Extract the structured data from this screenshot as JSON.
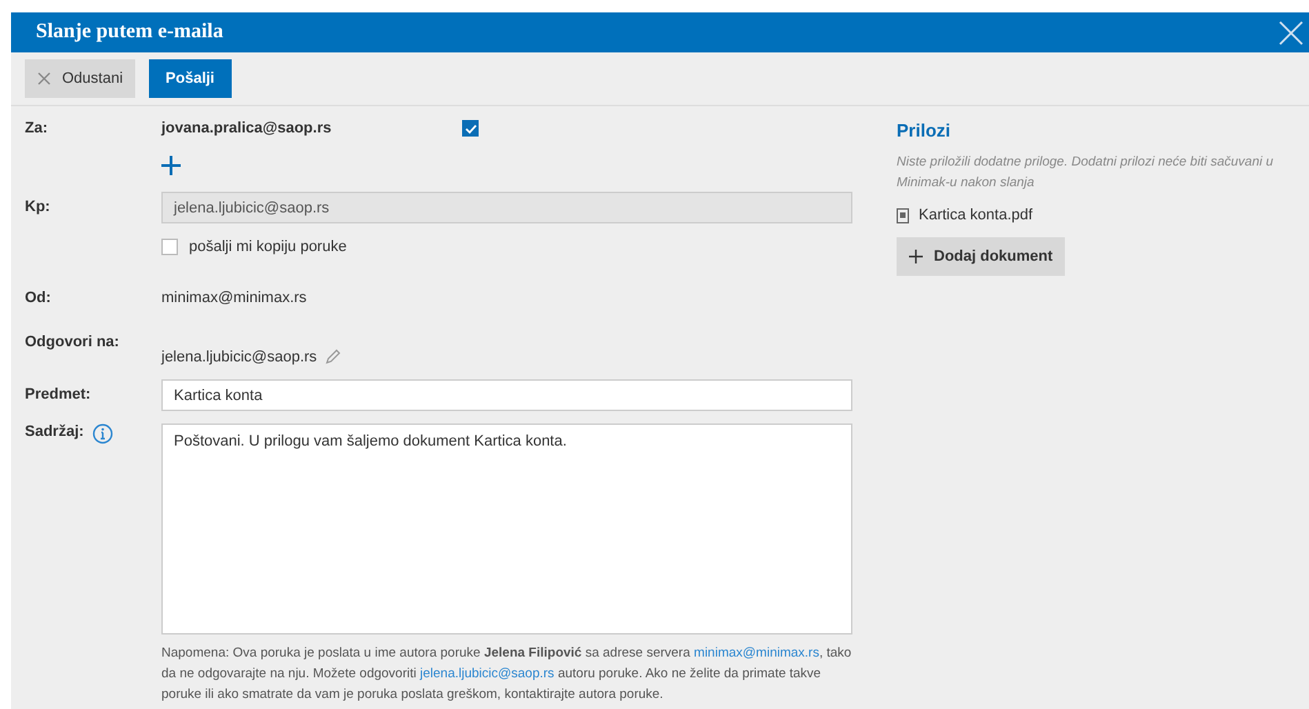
{
  "window": {
    "title": "Slanje putem e-maila"
  },
  "toolbar": {
    "cancel": "Odustani",
    "send": "Pošalji"
  },
  "to": {
    "label": "Za:",
    "value": "jovana.pralica@saop.rs",
    "checked": true
  },
  "cc": {
    "label": "Kp:",
    "value": "jelena.ljubicic@saop.rs",
    "copy_label": "pošalji mi kopiju poruke",
    "copy_checked": false
  },
  "from": {
    "label": "Od:",
    "value": "minimax@minimax.rs"
  },
  "reply_to": {
    "label": "Odgovori na:",
    "value": "jelena.ljubicic@saop.rs"
  },
  "subject": {
    "label": "Predmet:",
    "value": "Kartica konta"
  },
  "body": {
    "label": "Sadržaj:",
    "value": "Poštovani. U prilogu vam šaljemo dokument Kartica konta."
  },
  "note": [
    {
      "kind": "text",
      "text": "Napomena: Ova poruka je poslata u ime autora poruke "
    },
    {
      "kind": "bold",
      "text": "Jelena Filipović"
    },
    {
      "kind": "text",
      "text": " sa adrese servera "
    },
    {
      "kind": "link",
      "text": "minimax@minimax.rs"
    },
    {
      "kind": "text",
      "text": ", tako da ne odgovarajte na nju. Možete odgovoriti "
    },
    {
      "kind": "link",
      "text": "jelena.ljubicic@saop.rs"
    },
    {
      "kind": "text",
      "text": " autoru poruke. Ako ne želite da primate takve poruke ili ako smatrate da vam je poruka poslata greškom, kontaktirajte autora poruke."
    }
  ],
  "attachments": {
    "title": "Prilozi",
    "hint": "Niste priložili dodatne priloge. Dodatni prilozi neće biti sačuvani u Minimak-u nakon slanja",
    "files": [
      "Kartica konta.pdf"
    ],
    "add": "Dodaj dokument"
  }
}
